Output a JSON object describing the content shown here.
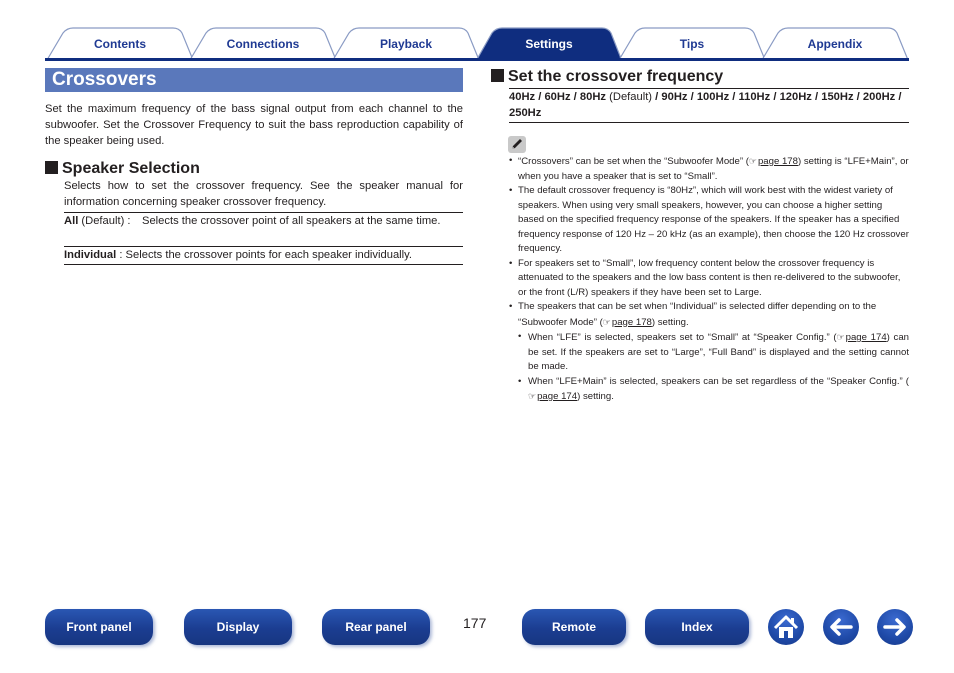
{
  "tabs": [
    {
      "label": "Contents",
      "active": false
    },
    {
      "label": "Connections",
      "active": false
    },
    {
      "label": "Playback",
      "active": false
    },
    {
      "label": "Settings",
      "active": true
    },
    {
      "label": "Tips",
      "active": false
    },
    {
      "label": "Appendix",
      "active": false
    }
  ],
  "page": {
    "title": "Crossovers",
    "intro": "Set the maximum frequency of the bass signal output from each channel to the subwoofer. Set the Crossover Frequency to suit the bass reproduction capability of the speaker being used.",
    "speaker_selection": {
      "heading": "Speaker Selection",
      "description": "Selects how to set the crossover frequency. See the speaker manual for information concerning speaker crossover frequency.",
      "options": [
        {
          "name": "All",
          "qualifier": "(Default) :",
          "text": "Selects the crossover point of all speakers at the same time."
        },
        {
          "name": "Individual",
          "qualifier": ":",
          "text": "Selects the crossover points for each speaker individually."
        }
      ]
    },
    "crossover_frequency": {
      "heading": "Set the crossover frequency",
      "values": [
        "40Hz",
        "60Hz",
        "80Hz",
        "90Hz",
        "100Hz",
        "110Hz",
        "120Hz",
        "150Hz",
        "200Hz",
        "250Hz"
      ],
      "default_label": "(Default)",
      "separator": " / "
    },
    "notes": {
      "icon": "pencil-icon",
      "items": [
        {
          "pre": "“Crossovers” can be set when the “Subwoofer Mode” (",
          "ref": "page 178",
          "post": ") setting is “LFE+Main”, or when you have a speaker that is set to “Small”."
        },
        {
          "text": "The default crossover frequency is “80Hz”, which will work best with the widest variety of speakers. When using very small speakers, however, you can choose a higher setting based on the specified frequency response of the speakers. If the speaker has a specified frequency response of 120 Hz – 20 kHz (as an example), then choose the 120 Hz crossover frequency."
        },
        {
          "text": "For speakers set to “Small”, low frequency content below the crossover frequency is attenuated to the speakers and the low bass content is then re-delivered to the subwoofer, or the front (L/R) speakers if they have been set to Large."
        },
        {
          "pre": "The speakers that can be set when “Individual” is selected differ depending on to the “Subwoofer Mode” (",
          "ref": "page 178",
          "post": ") setting."
        }
      ],
      "sub_items": [
        {
          "pre": "When “LFE” is selected, speakers set to “Small” at “Speaker Config.” (",
          "ref": "page 174",
          "post": ") can be set. If the speakers are set to “Large”, “Full Band” is displayed and the setting cannot be made."
        },
        {
          "pre": "When “LFE+Main” is selected, speakers can be set regardless of the “Speaker Config.” (",
          "ref": "page 174",
          "post": ") setting."
        }
      ]
    },
    "page_number": "177"
  },
  "bottom_nav": {
    "front_panel": "Front panel",
    "display": "Display",
    "rear_panel": "Rear panel",
    "remote": "Remote",
    "index": "Index",
    "home_icon": "home-icon",
    "back_icon": "arrow-left-icon",
    "forward_icon": "arrow-right-icon"
  },
  "colors": {
    "tab_active": "#0f2d7f",
    "tab_text": "#1f3a93",
    "title_bar": "#5a78bb",
    "nav_button": "#1b3d91"
  }
}
